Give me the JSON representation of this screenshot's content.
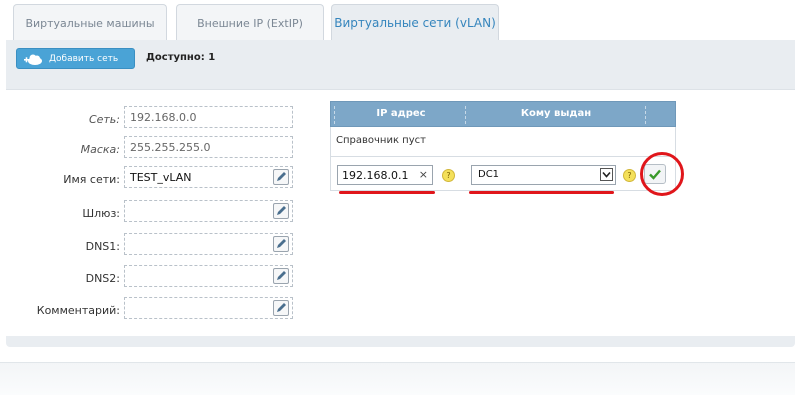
{
  "tabs": [
    {
      "label": "Виртуальные машины",
      "active": false
    },
    {
      "label": "Внешние IP (ExtIP)",
      "active": false
    },
    {
      "label": "Виртуальные сети (vLAN)",
      "active": true
    }
  ],
  "toolbar": {
    "add_label": "Добавить сеть",
    "available_label": "Доступно:",
    "available_value": "1"
  },
  "form": {
    "network": {
      "label": "Сеть:",
      "value": "192.168.0.0"
    },
    "mask": {
      "label": "Маска:",
      "value": "255.255.255.0"
    },
    "name": {
      "label": "Имя сети:",
      "value": "TEST_vLAN"
    },
    "gateway": {
      "label": "Шлюз:",
      "value": ""
    },
    "dns1": {
      "label": "DNS1:",
      "value": ""
    },
    "dns2": {
      "label": "DNS2:",
      "value": ""
    },
    "comment": {
      "label": "Комментарий:",
      "value": ""
    }
  },
  "table": {
    "columns": [
      "IP адрес",
      "Кому выдан"
    ],
    "empty_text": "Справочник пуст",
    "edit_row": {
      "ip": "192.168.0.1",
      "clear": "×",
      "assigned_to": "DC1"
    }
  },
  "colors": {
    "accent": "#3585bd",
    "header": "#7da7c8",
    "highlight": "#e0161b"
  }
}
